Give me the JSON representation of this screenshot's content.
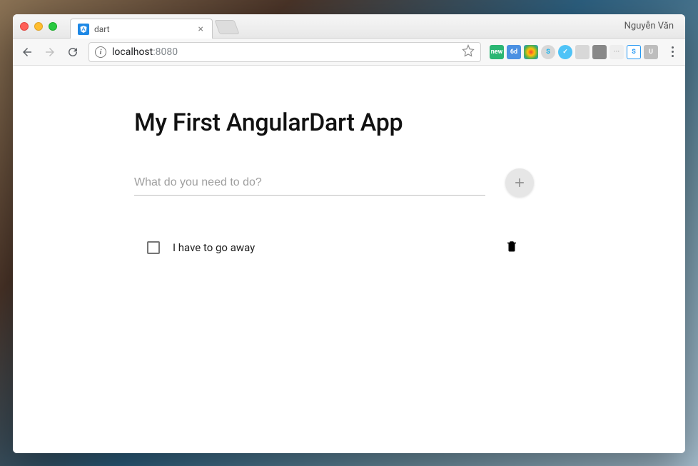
{
  "browser": {
    "tab": {
      "title": "dart",
      "favicon": "angular"
    },
    "user": "Nguyễn Văn",
    "url": {
      "host": "localhost",
      "port": ":8080"
    }
  },
  "app": {
    "title": "My First AngularDart App",
    "input": {
      "placeholder": "What do you need to do?",
      "value": ""
    },
    "todos": [
      {
        "text": "I have to go away",
        "done": false
      }
    ]
  },
  "icons": {
    "back": "←",
    "forward": "→",
    "reload": "⟳",
    "info": "i",
    "star": "☆",
    "plus": "+",
    "close": "×",
    "trash": "🗑"
  }
}
